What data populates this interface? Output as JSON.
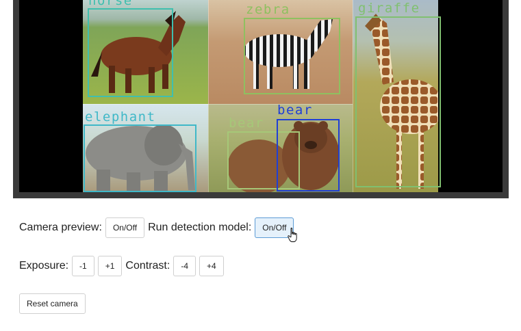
{
  "detections": [
    {
      "label": "horse",
      "color": "#3fbfae"
    },
    {
      "label": "zebra",
      "color": "#8fc060"
    },
    {
      "label": "giraffe",
      "color": "#80c070"
    },
    {
      "label": "elephant",
      "color": "#3fb8c8"
    },
    {
      "label": "bear",
      "color": "#a6c878"
    },
    {
      "label": "bear",
      "color": "#1f3fd6"
    }
  ],
  "controls": {
    "camera_preview_label": "Camera preview:",
    "camera_preview_toggle": "On/Off",
    "run_detection_label": "Run detection model:",
    "run_detection_toggle": "On/Off",
    "exposure_label": "Exposure:",
    "exposure_minus": "-1",
    "exposure_plus": "+1",
    "contrast_label": "Contrast:",
    "contrast_minus": "-4",
    "contrast_plus": "+4",
    "reset_camera": "Reset camera"
  },
  "icons": {
    "cursor": "hand-pointer-icon"
  },
  "colors": {
    "hover_button_bg": "#e5f1fb",
    "hover_button_border": "#5b9bd5"
  }
}
